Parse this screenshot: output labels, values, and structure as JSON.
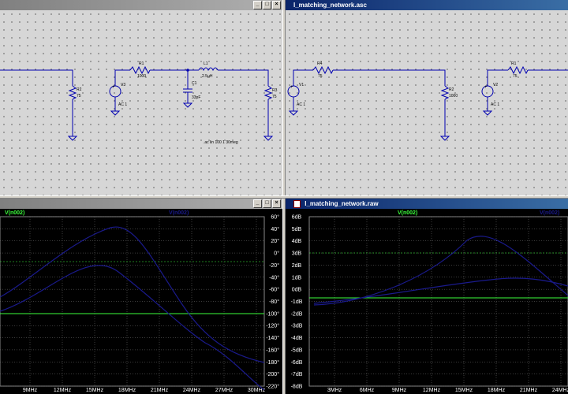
{
  "windows": {
    "top_left": {
      "title": ""
    },
    "top_right": {
      "title": "l_matching_network.asc"
    },
    "bottom_left": {
      "title": ""
    },
    "bottom_right": {
      "title": "l_matching_network.raw"
    }
  },
  "window_buttons": {
    "minimize": "_",
    "maximize": "□",
    "close": "×"
  },
  "schematic_left": {
    "components": {
      "r2": {
        "name": "R2",
        "value": "75"
      },
      "v3": {
        "name": "V3",
        "value": "AC 1"
      },
      "r1": {
        "name": "R1",
        "value": "1000"
      },
      "l1": {
        "name": "L1",
        "value": "2.5µH"
      },
      "c1": {
        "name": "C1",
        "value": "33pF"
      },
      "r3": {
        "name": "R3",
        "value": "75"
      }
    },
    "directive": ".ac lin 100 1 30meg"
  },
  "schematic_right": {
    "components": {
      "r4": {
        "name": "R4",
        "value": "75"
      },
      "v1": {
        "name": "V1",
        "value": "AC 1"
      },
      "r2": {
        "name": "R2",
        "value": "1000"
      },
      "v2": {
        "name": "V2",
        "value": "AC 1"
      },
      "r1": {
        "name": "R1",
        "value": "75"
      }
    }
  },
  "plot_left": {
    "trace_label": "V(n002)",
    "trace_color": "#3cff3c",
    "phase_color": "#1a1a8c",
    "x_ticks": [
      "9MHz",
      "12MHz",
      "15MHz",
      "18MHz",
      "21MHz",
      "24MHz",
      "27MHz",
      "30MHz"
    ],
    "y_right_ticks": [
      "60°",
      "40°",
      "20°",
      "0°",
      "-20°",
      "-40°",
      "-60°",
      "-80°",
      "-100°",
      "-120°",
      "-140°",
      "-160°",
      "-180°",
      "-200°",
      "-220°"
    ]
  },
  "plot_right": {
    "trace_label": "V(n002)",
    "trace_color": "#3cff3c",
    "phase_color": "#1a1a8c",
    "x_ticks": [
      "3MHz",
      "6MHz",
      "9MHz",
      "12MHz",
      "15MHz",
      "18MHz",
      "21MHz",
      "24MHz"
    ],
    "y_left_ticks": [
      "6dB",
      "5dB",
      "4dB",
      "3dB",
      "2dB",
      "1dB",
      "0dB",
      "-1dB",
      "-2dB",
      "-3dB",
      "-4dB",
      "-5dB",
      "-6dB",
      "-7dB",
      "-8dB"
    ]
  }
}
